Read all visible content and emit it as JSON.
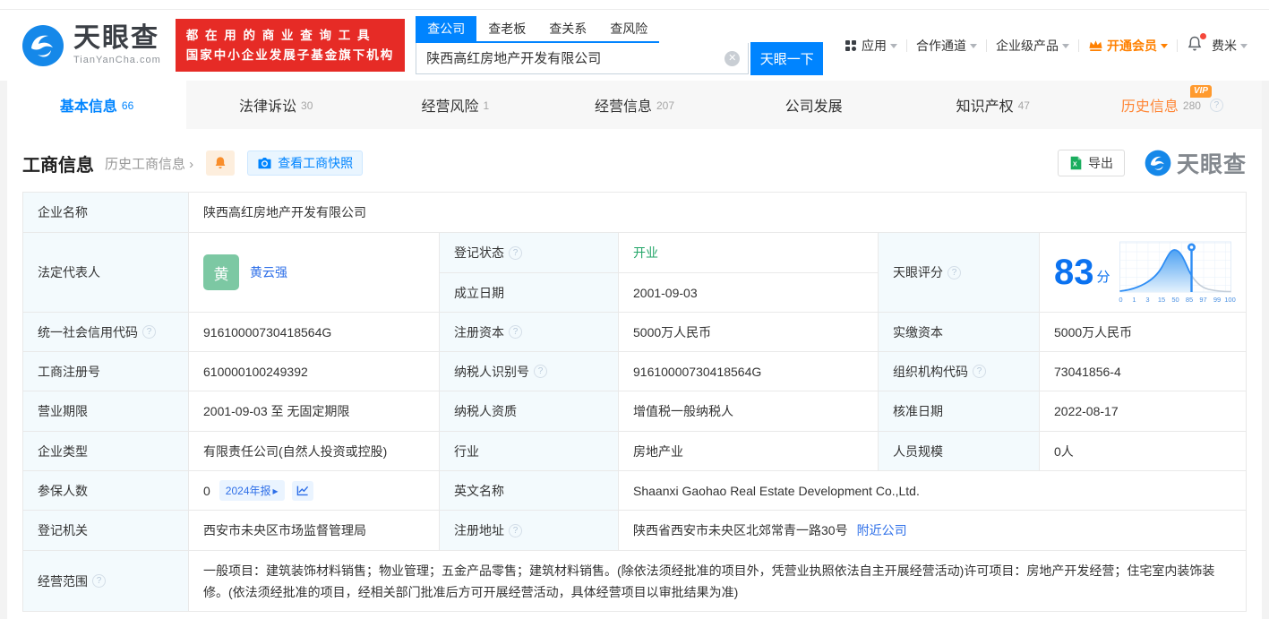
{
  "colors": {
    "accent": "#0084ff",
    "link": "#2e6fe8",
    "banner_red": "#e62b26",
    "vip_orange": "#ff8000",
    "status_green": "#21a567",
    "avatar_green": "#7cc8a3",
    "label_bg": "#f3fafd"
  },
  "header": {
    "logo": {
      "brand": "天眼查",
      "domain": "TianYanCha.com"
    },
    "banner": {
      "line1": "都 在 用 的 商 业 查 询 工 具",
      "line2": "国家中小企业发展子基金旗下机构"
    },
    "search": {
      "tabs": [
        {
          "label": "查公司"
        },
        {
          "label": "查老板"
        },
        {
          "label": "查关系"
        },
        {
          "label": "查风险"
        }
      ],
      "value": "陕西高红房地产开发有限公司",
      "button": "天眼一下"
    },
    "nav": {
      "apps": "应用",
      "partner": "合作通道",
      "enterprise": "企业级产品",
      "vip": "开通会员",
      "user": "费米"
    }
  },
  "tabs": [
    {
      "label": "基本信息",
      "count": "66"
    },
    {
      "label": "法律诉讼",
      "count": "30"
    },
    {
      "label": "经营风险",
      "count": "1"
    },
    {
      "label": "经营信息",
      "count": "207"
    },
    {
      "label": "公司发展",
      "count": ""
    },
    {
      "label": "知识产权",
      "count": "47"
    },
    {
      "label": "历史信息",
      "count": "280",
      "vip": "VIP"
    }
  ],
  "section": {
    "title": "工商信息",
    "history_link": "历史工商信息",
    "snapshot_button": "查看工商快照",
    "export_button": "导出",
    "watermark": "天眼查"
  },
  "fields": {
    "company_name": {
      "label": "企业名称",
      "value": "陕西高红房地产开发有限公司"
    },
    "legal_rep": {
      "label": "法定代表人",
      "value": "黄云强",
      "avatar": "黄"
    },
    "reg_status": {
      "label": "登记状态",
      "value": "开业"
    },
    "est_date": {
      "label": "成立日期",
      "value": "2001-09-03"
    },
    "score": {
      "label": "天眼评分",
      "value": "83",
      "unit": "分"
    },
    "credit_code": {
      "label": "统一社会信用代码",
      "value": "91610000730418564G"
    },
    "reg_capital": {
      "label": "注册资本",
      "value": "5000万人民币"
    },
    "paid_capital": {
      "label": "实缴资本",
      "value": "5000万人民币"
    },
    "reg_number": {
      "label": "工商注册号",
      "value": "610000100249392"
    },
    "taxpayer_id": {
      "label": "纳税人识别号",
      "value": "91610000730418564G"
    },
    "org_code": {
      "label": "组织机构代码",
      "value": "73041856-4"
    },
    "biz_term": {
      "label": "营业期限",
      "value": "2001-09-03 至 无固定期限"
    },
    "taxpayer_quality": {
      "label": "纳税人资质",
      "value": "增值税一般纳税人"
    },
    "approval_date": {
      "label": "核准日期",
      "value": "2022-08-17"
    },
    "company_type": {
      "label": "企业类型",
      "value": "有限责任公司(自然人投资或控股)"
    },
    "industry": {
      "label": "行业",
      "value": "房地产业"
    },
    "staff_size": {
      "label": "人员规模",
      "value": "0人"
    },
    "insured": {
      "label": "参保人数",
      "value": "0",
      "report_badge": "2024年报"
    },
    "english_name": {
      "label": "英文名称",
      "value": "Shaanxi Gaohao Real Estate Development Co.,Ltd."
    },
    "reg_authority": {
      "label": "登记机关",
      "value": "西安市未央区市场监督管理局"
    },
    "reg_address": {
      "label": "注册地址",
      "value": "陕西省西安市未央区北郊常青一路30号",
      "nearby_link": "附近公司"
    },
    "biz_scope": {
      "label": "经营范围",
      "value": "一般项目：建筑装饰材料销售；物业管理；五金产品零售；建筑材料销售。(除依法须经批准的项目外，凭营业执照依法自主开展经营活动)许可项目：房地产开发经营；住宅室内装饰装修。(依法须经批准的项目，经相关部门批准后方可开展经营活动，具体经营项目以审批结果为准)"
    }
  },
  "chart_data": {
    "type": "area",
    "title": "天眼评分分布曲线",
    "score": 83,
    "marker_x": "85",
    "x_ticks": [
      "0",
      "1",
      "3",
      "15",
      "50",
      "85",
      "97",
      "99",
      "100"
    ]
  }
}
